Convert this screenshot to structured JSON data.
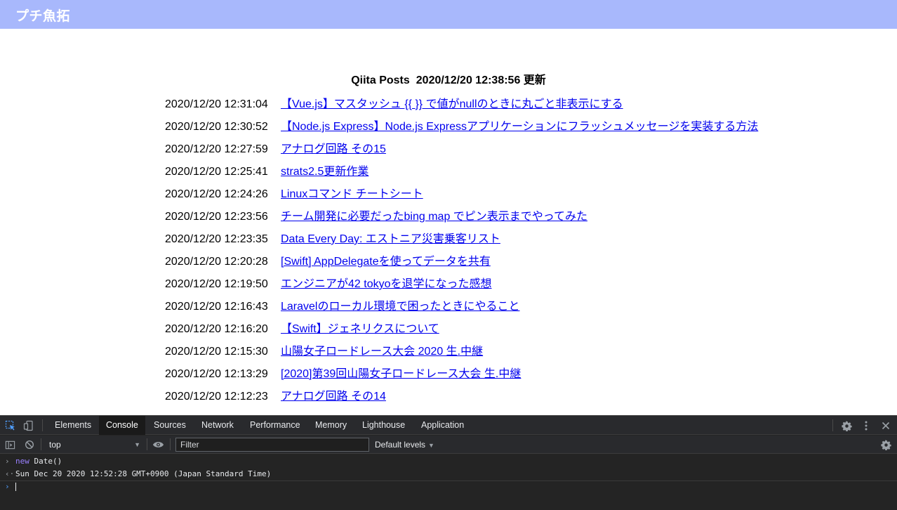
{
  "header": {
    "title": "プチ魚拓"
  },
  "main": {
    "heading": "Qiita Posts",
    "updated": "2020/12/20 12:38:56 更新",
    "posts": [
      {
        "time": "2020/12/20 12:31:04",
        "title": "【Vue.js】マスタッシュ {{ }} で値がnullのときに丸ごと非表示にする"
      },
      {
        "time": "2020/12/20 12:30:52",
        "title": "【Node.js Express】Node.js Expressアプリケーションにフラッシュメッセージを実装する方法"
      },
      {
        "time": "2020/12/20 12:27:59",
        "title": "アナログ回路 その15"
      },
      {
        "time": "2020/12/20 12:25:41",
        "title": "strats2.5更新作業"
      },
      {
        "time": "2020/12/20 12:24:26",
        "title": "Linuxコマンド チートシート"
      },
      {
        "time": "2020/12/20 12:23:56",
        "title": "チーム開発に必要だったbing map でピン表示までやってみた"
      },
      {
        "time": "2020/12/20 12:23:35",
        "title": "Data Every Day: エストニア災害乗客リスト"
      },
      {
        "time": "2020/12/20 12:20:28",
        "title": "[Swift] AppDelegateを使ってデータを共有"
      },
      {
        "time": "2020/12/20 12:19:50",
        "title": "エンジニアが42 tokyoを退学になった感想"
      },
      {
        "time": "2020/12/20 12:16:43",
        "title": "Laravelのローカル環境で困ったときにやること"
      },
      {
        "time": "2020/12/20 12:16:20",
        "title": "【Swift】ジェネリクスについて"
      },
      {
        "time": "2020/12/20 12:15:30",
        "title": "山陽女子ロードレース大会 2020 生.中継"
      },
      {
        "time": "2020/12/20 12:13:29",
        "title": "[2020]第39回山陽女子ロードレース大会 生.中継"
      },
      {
        "time": "2020/12/20 12:12:23",
        "title": "アナログ回路 その14"
      }
    ]
  },
  "devtools": {
    "tabs": [
      "Elements",
      "Console",
      "Sources",
      "Network",
      "Performance",
      "Memory",
      "Lighthouse",
      "Application"
    ],
    "active_tab": "Console",
    "context": "top",
    "filter_placeholder": "Filter",
    "levels": "Default levels",
    "console": {
      "input_keyword": "new",
      "input_rest": " Date()",
      "output": "Sun Dec 20 2020 12:52:28 GMT+0900 (Japan Standard Time)"
    },
    "colors": {
      "accent_header": "#a8b8fc",
      "link": "#0000ee",
      "keyword": "#9980ff",
      "prompt": "#4f9cfb"
    }
  }
}
